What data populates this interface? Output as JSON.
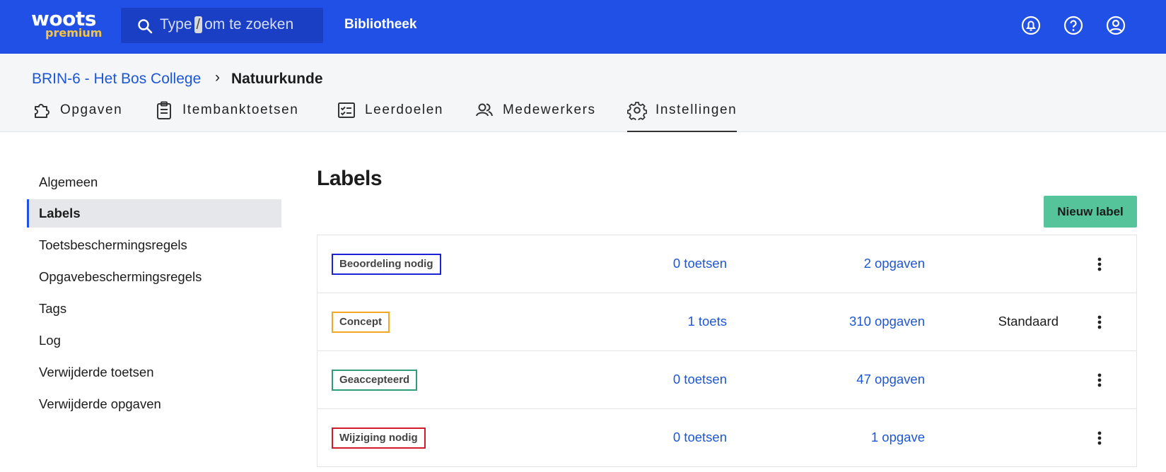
{
  "app": {
    "logo_text": "woots",
    "logo_sub": "premium",
    "search_prefix": "Type",
    "search_key": "/",
    "search_suffix": "om te zoeken",
    "library_link": "Bibliotheek"
  },
  "colors": {
    "brand": "#2150e6",
    "premium": "#f5c542",
    "accent_button": "#55c49a",
    "link": "#1d56d6"
  },
  "breadcrumb": {
    "parent": "BRIN-6 - Het Bos College",
    "separator": "›",
    "current": "Natuurkunde"
  },
  "tabs": [
    {
      "label": "Opgaven",
      "icon": "puzzle-icon",
      "active": false
    },
    {
      "label": "Itembanktoetsen",
      "icon": "clipboard-icon",
      "active": false
    },
    {
      "label": "Leerdoelen",
      "icon": "checklist-icon",
      "active": false
    },
    {
      "label": "Medewerkers",
      "icon": "people-icon",
      "active": false
    },
    {
      "label": "Instellingen",
      "icon": "gear-icon",
      "active": true
    }
  ],
  "sidebar": {
    "items": [
      {
        "label": "Algemeen",
        "active": false
      },
      {
        "label": "Labels",
        "active": true
      },
      {
        "label": "Toetsbeschermingsregels",
        "active": false
      },
      {
        "label": "Opgavebeschermingsregels",
        "active": false
      },
      {
        "label": "Tags",
        "active": false
      },
      {
        "label": "Log",
        "active": false
      },
      {
        "label": "Verwijderde toetsen",
        "active": false
      },
      {
        "label": "Verwijderde opgaven",
        "active": false
      }
    ]
  },
  "main": {
    "title": "Labels",
    "new_button": "Nieuw label",
    "rows": [
      {
        "name": "Beoordeling nodig",
        "color": "#1a23d6",
        "tests": "0 toetsen",
        "items": "2 opgaven",
        "default": ""
      },
      {
        "name": "Concept",
        "color": "#f5a623",
        "tests": "1 toets",
        "items": "310 opgaven",
        "default": "Standaard"
      },
      {
        "name": "Geaccepteerd",
        "color": "#2e9e7a",
        "tests": "0 toetsen",
        "items": "47 opgaven",
        "default": ""
      },
      {
        "name": "Wijziging nodig",
        "color": "#d11a2a",
        "tests": "0 toetsen",
        "items": "1 opgave",
        "default": ""
      }
    ]
  }
}
